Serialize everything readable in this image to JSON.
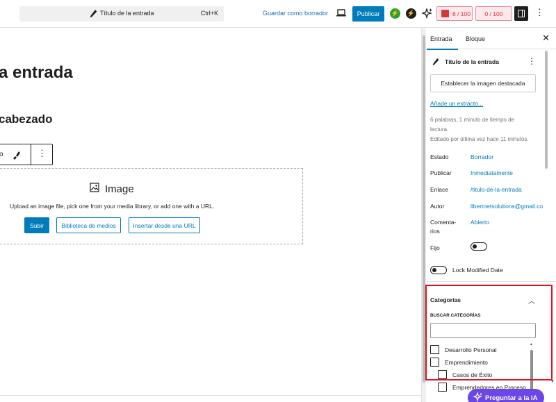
{
  "topbar": {
    "command_title": "Título de la entrada",
    "command_shortcut": "Ctrl+K",
    "save_draft": "Guardar como borrador",
    "publish": "Publicar",
    "seo_score": "8 / 100",
    "readability_score": "0 / 100",
    "accent": "#007cba"
  },
  "canvas": {
    "post_title_fragment": "a entrada",
    "heading_fragment": "cabezado",
    "toolbar_fragment": "o",
    "image_block": {
      "label": "Image",
      "instructions": "Upload an image file, pick one from your media library, or add one with a URL.",
      "upload": "Subir",
      "library": "Biblioteca de medios",
      "url": "Insertar desde una URL"
    }
  },
  "sidebar": {
    "tabs": [
      "Entrada",
      "Bloque"
    ],
    "post_title": "Título de la entrada",
    "featured_image": "Establecer la imagen destacada",
    "excerpt": "Añade un extracto...",
    "meta_line1": "6 palabras, 1 minuto de tiempo de",
    "meta_line2": "lectura.",
    "meta_line3": "Editado por última vez hace 11 minutos.",
    "rows": {
      "estado_label": "Estado",
      "estado_value": "Borrador",
      "publicar_label": "Publicar",
      "publicar_value": "Inmediatamente",
      "enlace_label": "Enlace",
      "enlace_value": "/titulo-de-la-entrada",
      "autor_label": "Autor",
      "autor_value": "libertnetsolutions@gmail.co",
      "comentarios_label1": "Comenta-",
      "comentarios_label2": "rios",
      "comentarios_value": "Abierto",
      "fijo_label": "Fijo"
    },
    "lock_modified": "Lock Modified Date",
    "categories": {
      "title": "Categorías",
      "search_label": "BUSCAR CATEGORÍAS",
      "items": [
        "Desarrollo Personal",
        "Emprendimiento",
        "Casos de Éxito",
        "Emprendedores en Proceso"
      ]
    }
  },
  "ai_button": "Preguntar a la IA"
}
